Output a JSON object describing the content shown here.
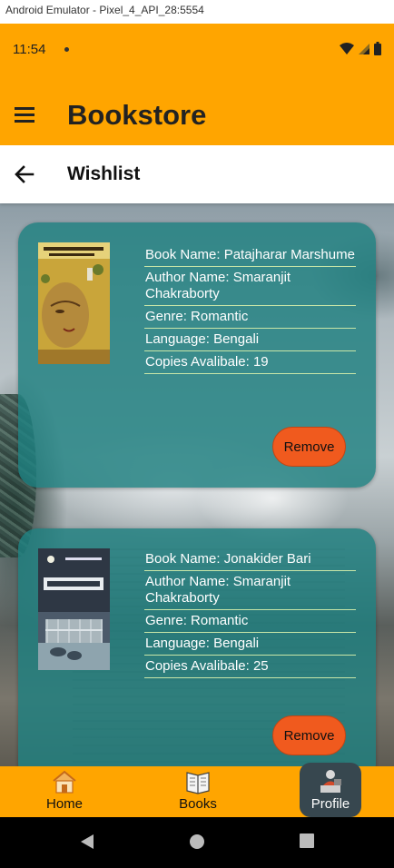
{
  "emulator": {
    "title": "Android Emulator - Pixel_4_API_28:5554"
  },
  "status_bar": {
    "time": "11:54"
  },
  "app_bar": {
    "title": "Bookstore"
  },
  "sub_bar": {
    "title": "Wishlist"
  },
  "colors": {
    "primary": "#FFA500",
    "card": "#1E8080",
    "remove_button": "#F05A1E",
    "divider": "#C8E6A8",
    "active_nav": "#37474F"
  },
  "wishlist": [
    {
      "book_name": "Book Name: Patajharar Marshume",
      "author": "Author Name: Smaranjit Chakraborty",
      "genre": "Genre: Romantic",
      "language": "Language: Bengali",
      "copies": "Copies Avalibale: 19",
      "remove_label": "Remove"
    },
    {
      "book_name": "Book Name: Jonakider Bari",
      "author": "Author Name: Smaranjit Chakraborty",
      "genre": "Genre: Romantic",
      "language": "Language: Bengali",
      "copies": "Copies Avalibale: 25",
      "remove_label": "Remove"
    }
  ],
  "bottom_nav": {
    "items": [
      {
        "label": "Home",
        "icon": "home-icon",
        "active": false
      },
      {
        "label": "Books",
        "icon": "books-icon",
        "active": false
      },
      {
        "label": "Profile",
        "icon": "profile-icon",
        "active": true
      }
    ]
  }
}
